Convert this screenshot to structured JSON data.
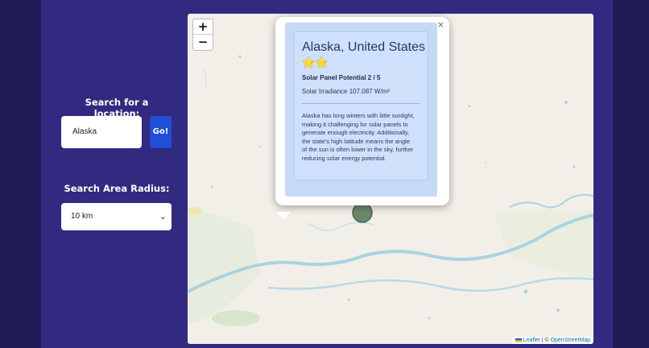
{
  "sidebar": {
    "search_label": "Search for a location:",
    "search_value": "Alaska",
    "go_label": "Go!",
    "radius_label": "Search Area Radius:",
    "radius_value": "10 km"
  },
  "map": {
    "zoom_in": "+",
    "zoom_out": "−",
    "attribution": {
      "leaflet": "Leaflet",
      "separator": " | © ",
      "osm": "OpenStreetMap"
    },
    "popup": {
      "close": "×",
      "title": "Alaska, United States",
      "stars": "⭐⭐",
      "star_rating": 2,
      "star_max": 5,
      "rating": "Solar Panel Potential 2 / 5",
      "irradiance": "Solar Irradiance 107.087 W/m²",
      "description": "Alaska has long winters with little sunlight, making it challenging for solar panels to generate enough electricity. Additionally, the state's high latitude means the angle of the sun is often lower in the sky, further reducing solar energy potential."
    },
    "icons": {
      "marker": "map-marker-icon",
      "flag": "ukraine-flag-icon",
      "chevron": "chevron-down-icon",
      "close": "close-icon"
    }
  },
  "colors": {
    "page_bg": "#211b55",
    "panel_bg": "#312a80",
    "go_button": "#1f4fd6",
    "card_bg": "#c6daf8",
    "water": "#aad3df",
    "marker": "#5d7f5d"
  }
}
